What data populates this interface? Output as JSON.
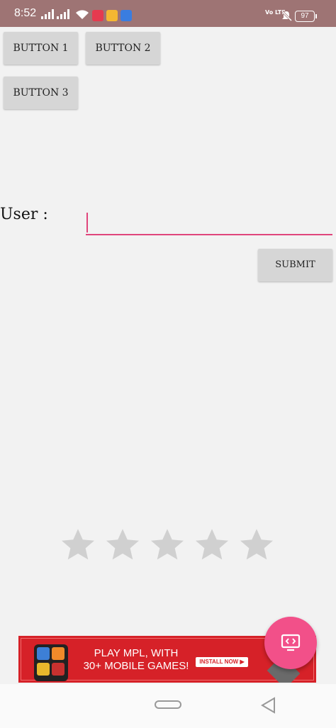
{
  "status_bar": {
    "time": "8:52",
    "volte": "Vo LTE",
    "battery": "97",
    "icons": [
      "signal-icon",
      "signal-icon",
      "wifi-icon",
      "video-call-icon",
      "download-icon",
      "usb-icon",
      "volte-icon",
      "mute-icon",
      "battery-icon"
    ]
  },
  "buttons": {
    "button1": "BUTTON 1",
    "button2": "BUTTON 2",
    "button3": "BUTTON 3",
    "submit": "SUBMIT"
  },
  "form": {
    "user_label": "User :",
    "user_value": ""
  },
  "rating": {
    "stars_total": 5,
    "stars_selected": 0,
    "empty_color": "#d0d0d0"
  },
  "ad": {
    "text_line1": "PLAY MPL, WITH",
    "text_line2": "30+ MOBILE GAMES!",
    "cta": "INSTALL NOW ▶"
  },
  "fab": {
    "icon": "code-screen-icon",
    "color": "#f25089"
  },
  "nav": {
    "icons": [
      "home-pill-icon",
      "back-icon"
    ]
  },
  "colors": {
    "status_bar": "#9e7474",
    "accent": "#e0457b",
    "button_bg": "#d6d6d6",
    "ad_red": "#d62128"
  }
}
